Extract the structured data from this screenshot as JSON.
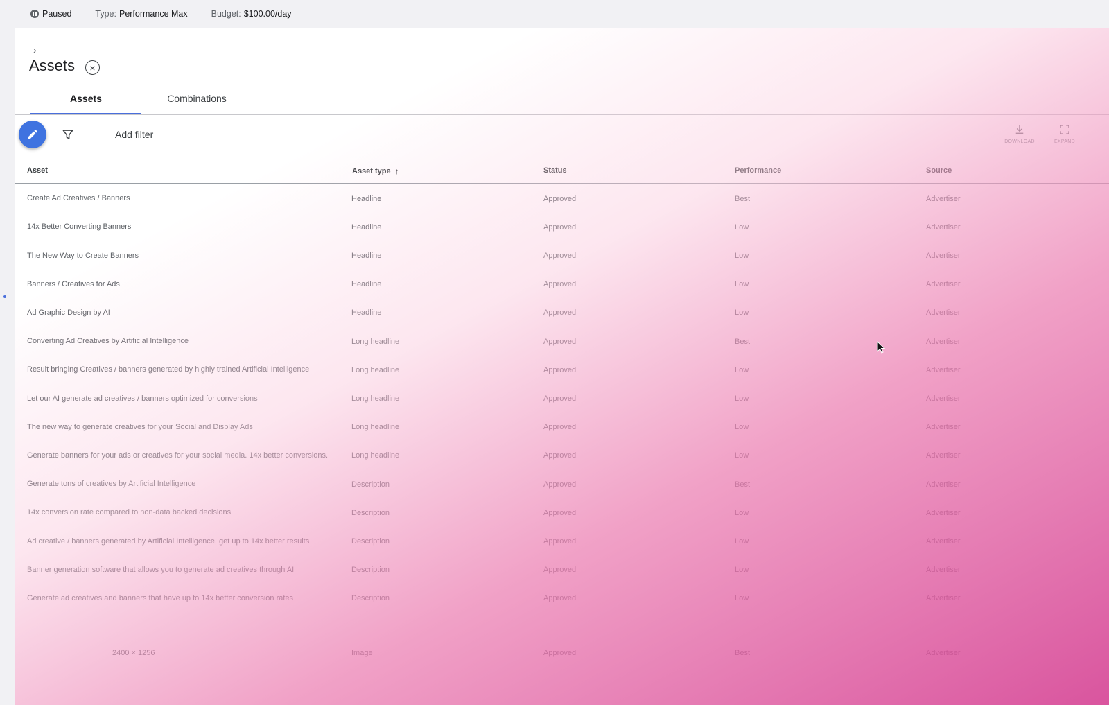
{
  "topbar": {
    "status": "Paused",
    "type_label": "Type:",
    "type_value": "Performance Max",
    "budget_label": "Budget:",
    "budget_value": "$100.00/day"
  },
  "page": {
    "title": "Assets"
  },
  "tabs": [
    {
      "label": "Assets"
    },
    {
      "label": "Combinations"
    }
  ],
  "toolbar": {
    "add_filter": "Add filter",
    "download_label": "DOWNLOAD",
    "expand_label": "EXPAND"
  },
  "table": {
    "headers": {
      "asset": "Asset",
      "asset_type": "Asset type",
      "status": "Status",
      "performance": "Performance",
      "source": "Source"
    },
    "rows": [
      {
        "asset": "Create Ad Creatives / Banners",
        "type": "Headline",
        "status": "Approved",
        "performance": "Best",
        "source": "Advertiser"
      },
      {
        "asset": "14x Better Converting Banners",
        "type": "Headline",
        "status": "Approved",
        "performance": "Low",
        "source": "Advertiser"
      },
      {
        "asset": "The New Way to Create Banners",
        "type": "Headline",
        "status": "Approved",
        "performance": "Low",
        "source": "Advertiser"
      },
      {
        "asset": "Banners / Creatives for Ads",
        "type": "Headline",
        "status": "Approved",
        "performance": "Low",
        "source": "Advertiser"
      },
      {
        "asset": "Ad Graphic Design by AI",
        "type": "Headline",
        "status": "Approved",
        "performance": "Low",
        "source": "Advertiser"
      },
      {
        "asset": "Converting Ad Creatives by Artificial Intelligence",
        "type": "Long headline",
        "status": "Approved",
        "performance": "Best",
        "source": "Advertiser"
      },
      {
        "asset": "Result bringing Creatives / banners generated by highly trained Artificial Intelligence",
        "type": "Long headline",
        "status": "Approved",
        "performance": "Low",
        "source": "Advertiser"
      },
      {
        "asset": "Let our AI generate ad creatives / banners optimized for conversions",
        "type": "Long headline",
        "status": "Approved",
        "performance": "Low",
        "source": "Advertiser"
      },
      {
        "asset": "The new way to generate creatives for your Social and Display Ads",
        "type": "Long headline",
        "status": "Approved",
        "performance": "Low",
        "source": "Advertiser"
      },
      {
        "asset": "Generate banners for your ads or creatives for your social media. 14x better conversions.",
        "type": "Long headline",
        "status": "Approved",
        "performance": "Low",
        "source": "Advertiser"
      },
      {
        "asset": "Generate tons of creatives by Artificial Intelligence",
        "type": "Description",
        "status": "Approved",
        "performance": "Best",
        "source": "Advertiser"
      },
      {
        "asset": "14x conversion rate compared to non-data backed decisions",
        "type": "Description",
        "status": "Approved",
        "performance": "Low",
        "source": "Advertiser"
      },
      {
        "asset": "Ad creative / banners generated by Artificial Intelligence, get up to 14x better results",
        "type": "Description",
        "status": "Approved",
        "performance": "Low",
        "source": "Advertiser"
      },
      {
        "asset": "Banner generation software that allows you to generate ad creatives through AI",
        "type": "Description",
        "status": "Approved",
        "performance": "Low",
        "source": "Advertiser"
      },
      {
        "asset": "Generate ad creatives and banners that have up to 14x better conversion rates",
        "type": "Description",
        "status": "Approved",
        "performance": "Low",
        "source": "Advertiser"
      }
    ],
    "image_rows": [
      {
        "asset": "2400 × 1256",
        "type": "Image",
        "status": "Approved",
        "performance": "Best",
        "source": "Advertiser"
      }
    ]
  }
}
